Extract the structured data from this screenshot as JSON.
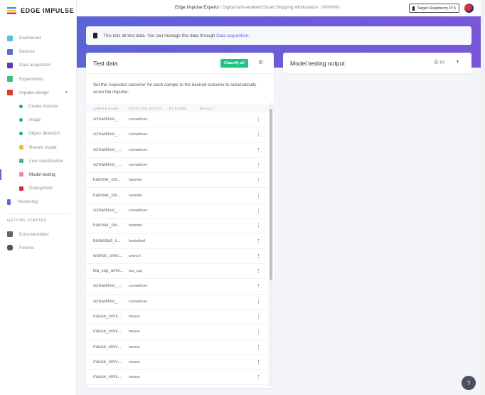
{
  "brand": "EDGE IMPULSE",
  "sidebar": {
    "items": [
      {
        "label": "Dashboard",
        "color": "#4fc3e0"
      },
      {
        "label": "Devices",
        "color": "#5b6ad6"
      },
      {
        "label": "Data acquisition",
        "color": "#5b3fb0"
      },
      {
        "label": "Experiments",
        "color": "#3dbd8b"
      },
      {
        "label": "Impulse design",
        "color": "#e2382b"
      }
    ],
    "sub": [
      {
        "label": "Create impulse"
      },
      {
        "label": "Image"
      },
      {
        "label": "Object detection"
      },
      {
        "label": "Retrain model",
        "color": "#f0c020"
      },
      {
        "label": "Live classification",
        "color": "#3dbd8b"
      },
      {
        "label": "Model testing",
        "color": "#e8879a"
      },
      {
        "label": "Deployment",
        "color": "#d6243a"
      }
    ],
    "versioning": "Versioning",
    "section": "GETTING STARTED",
    "documentation": "Documentation",
    "forums": "Forums"
  },
  "header": {
    "org": "Edge Impulse Experts",
    "sep": "/",
    "project": "Digital twin-enabled Smart Shipping Workstation",
    "badge": "ENTERPRISE",
    "target": "Target: Raspberry Pi 5"
  },
  "notice": {
    "text": "This lists all test data. You can manage this data through ",
    "link": "Data acquisition",
    "end": "."
  },
  "test": {
    "title": "Test data",
    "classify": "Classify all",
    "desc": "Set the 'expected outcome' for each sample to the desired outcome to automatically score the impulse.",
    "columns": [
      "SAMPLE NAME",
      "EXPECTED OUTCO...",
      "F1 SCORE",
      "RESULT"
    ],
    "rows": [
      [
        "screwdriver_...",
        "screwdriver"
      ],
      [
        "screwdriver_...",
        "screwdriver"
      ],
      [
        "screwdriver_...",
        "screwdriver"
      ],
      [
        "screwdriver_...",
        "screwdriver"
      ],
      [
        "hammer_om...",
        "hammer"
      ],
      [
        "hammer_om...",
        "hammer"
      ],
      [
        "screwdriver_...",
        "screwdriver"
      ],
      [
        "hammer_om...",
        "hammer"
      ],
      [
        "basketball_o...",
        "basketball"
      ],
      [
        "wrench_omni...",
        "wrench"
      ],
      [
        "tea_cup_omni...",
        "tea_cup"
      ],
      [
        "screwdriver_...",
        "screwdriver"
      ],
      [
        "screwdriver_...",
        "screwdriver"
      ],
      [
        "mouse_omni...",
        "mouse"
      ],
      [
        "mouse_omni...",
        "mouse"
      ],
      [
        "mouse_omni...",
        "mouse"
      ],
      [
        "mouse_omni...",
        "mouse"
      ],
      [
        "mouse_omni...",
        "mouse"
      ]
    ]
  },
  "output": {
    "title": "Model testing output",
    "count": "(0)"
  }
}
